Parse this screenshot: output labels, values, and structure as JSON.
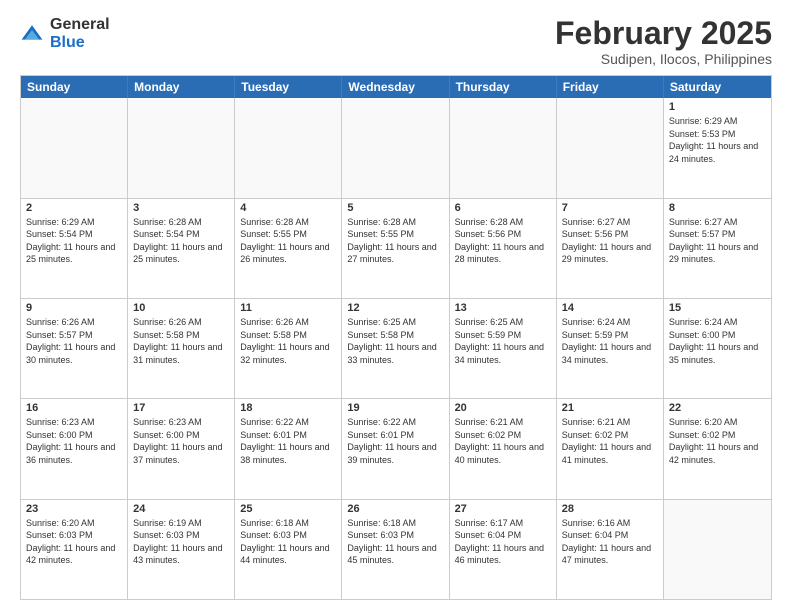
{
  "logo": {
    "general": "General",
    "blue": "Blue"
  },
  "header": {
    "month": "February 2025",
    "location": "Sudipen, Ilocos, Philippines"
  },
  "weekdays": [
    "Sunday",
    "Monday",
    "Tuesday",
    "Wednesday",
    "Thursday",
    "Friday",
    "Saturday"
  ],
  "rows": [
    [
      {
        "day": "",
        "sunrise": "",
        "sunset": "",
        "daylight": ""
      },
      {
        "day": "",
        "sunrise": "",
        "sunset": "",
        "daylight": ""
      },
      {
        "day": "",
        "sunrise": "",
        "sunset": "",
        "daylight": ""
      },
      {
        "day": "",
        "sunrise": "",
        "sunset": "",
        "daylight": ""
      },
      {
        "day": "",
        "sunrise": "",
        "sunset": "",
        "daylight": ""
      },
      {
        "day": "",
        "sunrise": "",
        "sunset": "",
        "daylight": ""
      },
      {
        "day": "1",
        "sunrise": "Sunrise: 6:29 AM",
        "sunset": "Sunset: 5:53 PM",
        "daylight": "Daylight: 11 hours and 24 minutes."
      }
    ],
    [
      {
        "day": "2",
        "sunrise": "Sunrise: 6:29 AM",
        "sunset": "Sunset: 5:54 PM",
        "daylight": "Daylight: 11 hours and 25 minutes."
      },
      {
        "day": "3",
        "sunrise": "Sunrise: 6:28 AM",
        "sunset": "Sunset: 5:54 PM",
        "daylight": "Daylight: 11 hours and 25 minutes."
      },
      {
        "day": "4",
        "sunrise": "Sunrise: 6:28 AM",
        "sunset": "Sunset: 5:55 PM",
        "daylight": "Daylight: 11 hours and 26 minutes."
      },
      {
        "day": "5",
        "sunrise": "Sunrise: 6:28 AM",
        "sunset": "Sunset: 5:55 PM",
        "daylight": "Daylight: 11 hours and 27 minutes."
      },
      {
        "day": "6",
        "sunrise": "Sunrise: 6:28 AM",
        "sunset": "Sunset: 5:56 PM",
        "daylight": "Daylight: 11 hours and 28 minutes."
      },
      {
        "day": "7",
        "sunrise": "Sunrise: 6:27 AM",
        "sunset": "Sunset: 5:56 PM",
        "daylight": "Daylight: 11 hours and 29 minutes."
      },
      {
        "day": "8",
        "sunrise": "Sunrise: 6:27 AM",
        "sunset": "Sunset: 5:57 PM",
        "daylight": "Daylight: 11 hours and 29 minutes."
      }
    ],
    [
      {
        "day": "9",
        "sunrise": "Sunrise: 6:26 AM",
        "sunset": "Sunset: 5:57 PM",
        "daylight": "Daylight: 11 hours and 30 minutes."
      },
      {
        "day": "10",
        "sunrise": "Sunrise: 6:26 AM",
        "sunset": "Sunset: 5:58 PM",
        "daylight": "Daylight: 11 hours and 31 minutes."
      },
      {
        "day": "11",
        "sunrise": "Sunrise: 6:26 AM",
        "sunset": "Sunset: 5:58 PM",
        "daylight": "Daylight: 11 hours and 32 minutes."
      },
      {
        "day": "12",
        "sunrise": "Sunrise: 6:25 AM",
        "sunset": "Sunset: 5:58 PM",
        "daylight": "Daylight: 11 hours and 33 minutes."
      },
      {
        "day": "13",
        "sunrise": "Sunrise: 6:25 AM",
        "sunset": "Sunset: 5:59 PM",
        "daylight": "Daylight: 11 hours and 34 minutes."
      },
      {
        "day": "14",
        "sunrise": "Sunrise: 6:24 AM",
        "sunset": "Sunset: 5:59 PM",
        "daylight": "Daylight: 11 hours and 34 minutes."
      },
      {
        "day": "15",
        "sunrise": "Sunrise: 6:24 AM",
        "sunset": "Sunset: 6:00 PM",
        "daylight": "Daylight: 11 hours and 35 minutes."
      }
    ],
    [
      {
        "day": "16",
        "sunrise": "Sunrise: 6:23 AM",
        "sunset": "Sunset: 6:00 PM",
        "daylight": "Daylight: 11 hours and 36 minutes."
      },
      {
        "day": "17",
        "sunrise": "Sunrise: 6:23 AM",
        "sunset": "Sunset: 6:00 PM",
        "daylight": "Daylight: 11 hours and 37 minutes."
      },
      {
        "day": "18",
        "sunrise": "Sunrise: 6:22 AM",
        "sunset": "Sunset: 6:01 PM",
        "daylight": "Daylight: 11 hours and 38 minutes."
      },
      {
        "day": "19",
        "sunrise": "Sunrise: 6:22 AM",
        "sunset": "Sunset: 6:01 PM",
        "daylight": "Daylight: 11 hours and 39 minutes."
      },
      {
        "day": "20",
        "sunrise": "Sunrise: 6:21 AM",
        "sunset": "Sunset: 6:02 PM",
        "daylight": "Daylight: 11 hours and 40 minutes."
      },
      {
        "day": "21",
        "sunrise": "Sunrise: 6:21 AM",
        "sunset": "Sunset: 6:02 PM",
        "daylight": "Daylight: 11 hours and 41 minutes."
      },
      {
        "day": "22",
        "sunrise": "Sunrise: 6:20 AM",
        "sunset": "Sunset: 6:02 PM",
        "daylight": "Daylight: 11 hours and 42 minutes."
      }
    ],
    [
      {
        "day": "23",
        "sunrise": "Sunrise: 6:20 AM",
        "sunset": "Sunset: 6:03 PM",
        "daylight": "Daylight: 11 hours and 42 minutes."
      },
      {
        "day": "24",
        "sunrise": "Sunrise: 6:19 AM",
        "sunset": "Sunset: 6:03 PM",
        "daylight": "Daylight: 11 hours and 43 minutes."
      },
      {
        "day": "25",
        "sunrise": "Sunrise: 6:18 AM",
        "sunset": "Sunset: 6:03 PM",
        "daylight": "Daylight: 11 hours and 44 minutes."
      },
      {
        "day": "26",
        "sunrise": "Sunrise: 6:18 AM",
        "sunset": "Sunset: 6:03 PM",
        "daylight": "Daylight: 11 hours and 45 minutes."
      },
      {
        "day": "27",
        "sunrise": "Sunrise: 6:17 AM",
        "sunset": "Sunset: 6:04 PM",
        "daylight": "Daylight: 11 hours and 46 minutes."
      },
      {
        "day": "28",
        "sunrise": "Sunrise: 6:16 AM",
        "sunset": "Sunset: 6:04 PM",
        "daylight": "Daylight: 11 hours and 47 minutes."
      },
      {
        "day": "",
        "sunrise": "",
        "sunset": "",
        "daylight": ""
      }
    ]
  ]
}
